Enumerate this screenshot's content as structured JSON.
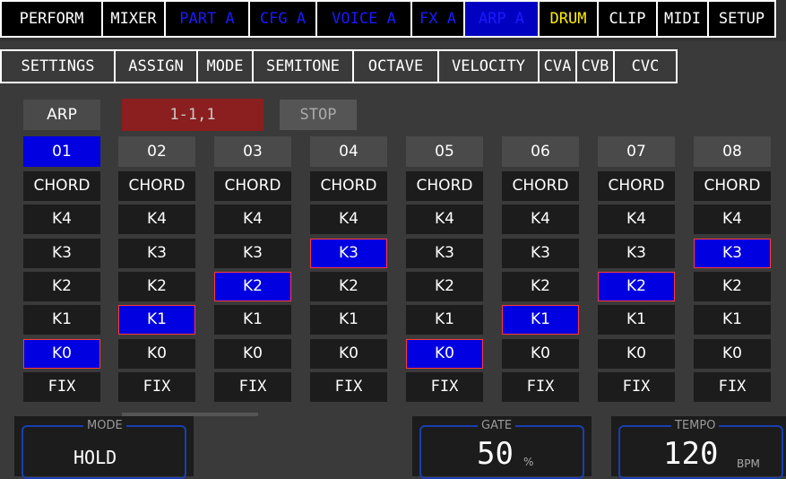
{
  "top_tabs": [
    {
      "label": "PERFORM",
      "color": "#ffffff"
    },
    {
      "label": "MIXER",
      "color": "#ffffff"
    },
    {
      "label": "PART A",
      "color": "#1a1aff"
    },
    {
      "label": "CFG A",
      "color": "#1a1aff"
    },
    {
      "label": "VOICE A",
      "color": "#1a1aff"
    },
    {
      "label": "FX A",
      "color": "#1a1aff"
    },
    {
      "label": "ARP A",
      "color": "#1a1aff"
    },
    {
      "label": "DRUM",
      "color": "#ffee00"
    },
    {
      "label": "CLIP",
      "color": "#ffffff"
    },
    {
      "label": "MIDI",
      "color": "#ffffff"
    },
    {
      "label": "SETUP",
      "color": "#ffffff"
    }
  ],
  "sub_tabs": [
    "SETTINGS",
    "ASSIGN",
    "MODE",
    "SEMITONE",
    "OCTAVE",
    "VELOCITY",
    "CVA",
    "CVB",
    "CVC"
  ],
  "controls": {
    "arp_label": "ARP",
    "position": "1-1,1",
    "stop_label": "STOP"
  },
  "steps": [
    {
      "num": "01",
      "selected": "K0"
    },
    {
      "num": "02",
      "selected": "K1"
    },
    {
      "num": "03",
      "selected": "K2"
    },
    {
      "num": "04",
      "selected": "K3"
    },
    {
      "num": "05",
      "selected": "K0"
    },
    {
      "num": "06",
      "selected": "K1"
    },
    {
      "num": "07",
      "selected": "K2"
    },
    {
      "num": "08",
      "selected": "K3"
    }
  ],
  "active_step": "01",
  "row_labels": [
    "CHORD",
    "K4",
    "K3",
    "K2",
    "K1",
    "K0",
    "FIX"
  ],
  "mode": {
    "label": "MODE",
    "value": "HOLD"
  },
  "gate": {
    "label": "GATE",
    "value": "50",
    "unit": "%"
  },
  "tempo": {
    "label": "TEMPO",
    "value": "120",
    "unit": "BPM"
  },
  "colors": {
    "accent_blue": "#0000e0",
    "highlight_red": "#ff3a3a",
    "position_bg": "#8b1e1e",
    "frame_blue": "#1a3fb0"
  }
}
